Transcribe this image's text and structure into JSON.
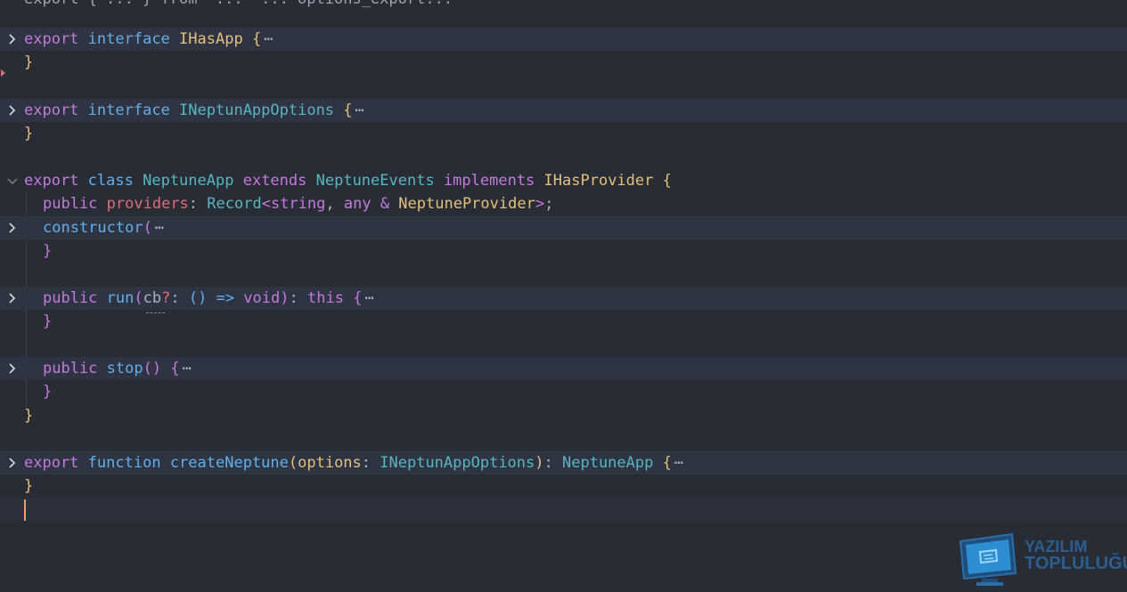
{
  "editor": {
    "top_partial": "export { ... } from '...' ... options_export...",
    "lines": {
      "l1": {
        "kw": "export",
        "kw2": "interface",
        "name": "IHasApp",
        "brace": "{",
        "ellipsis": "⋯"
      },
      "l2": {
        "brace": "}"
      },
      "l3": {
        "kw": "export",
        "kw2": "interface",
        "name": "INeptunAppOptions",
        "brace": "{",
        "ellipsis": "⋯"
      },
      "l4": {
        "brace": "}"
      },
      "l5": {
        "kw": "export",
        "kw2": "class",
        "name": "NeptuneApp",
        "kw3": "extends",
        "base": "NeptuneEvents",
        "kw4": "implements",
        "iface": "IHasProvider",
        "brace": "{"
      },
      "l6": {
        "kw": "public",
        "prop": "providers",
        "colon": ": ",
        "type": "Record",
        "lt": "<",
        "t1": "string",
        "comma": ", ",
        "t2": "any",
        "amp": " & ",
        "t3": "NeptuneProvider",
        "gt": ">",
        "semi": ";"
      },
      "l7": {
        "fn": "constructor",
        "paren": "(",
        "ellipsis": "⋯"
      },
      "l8": {
        "brace": "}"
      },
      "l9": {
        "kw": "public",
        "fn": "run",
        "paren_open": "(",
        "param": "cb",
        "opt": "?",
        "colon": ": ",
        "p2": "()",
        "arrow": " => ",
        "void": "void",
        "paren_close": ")",
        "colon2": ": ",
        "this": "this",
        "brace": "{",
        "ellipsis": "⋯"
      },
      "l10": {
        "brace": "}"
      },
      "l11": {
        "kw": "public",
        "fn": "stop",
        "parens": "()",
        "brace": "{",
        "ellipsis": "⋯"
      },
      "l12": {
        "brace": "}"
      },
      "l13": {
        "brace": "}"
      },
      "l14": {
        "kw": "export",
        "kw2": "function",
        "fn": "createNeptune",
        "paren_open": "(",
        "param": "options",
        "colon": ": ",
        "type": "INeptunAppOptions",
        "paren_close": ")",
        "colon2": ": ",
        "ret": "NeptuneApp",
        "brace": "{",
        "ellipsis": "⋯"
      },
      "l15": {
        "brace": "}"
      }
    }
  },
  "watermark": {
    "line1": "YAZILIM",
    "line2": "TOPLULUĞU"
  },
  "colors": {
    "background": "#282c34",
    "keyword": "#c678dd",
    "function": "#61afef",
    "type": "#56b6c2",
    "class": "#e5c07b",
    "property": "#e06c75"
  }
}
